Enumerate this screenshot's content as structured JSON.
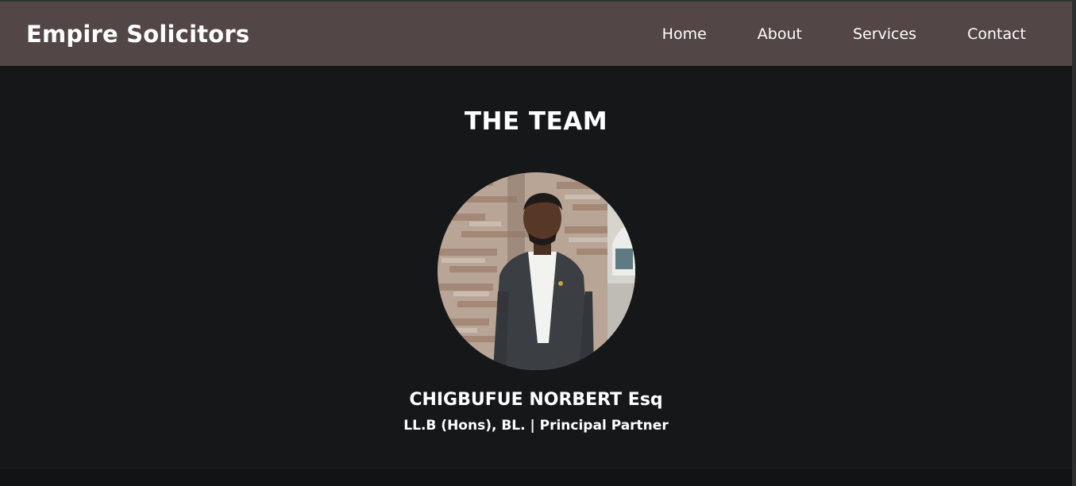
{
  "brand": {
    "name": "Empire Solicitors"
  },
  "nav": {
    "items": [
      {
        "label": "Home"
      },
      {
        "label": "About"
      },
      {
        "label": "Services"
      },
      {
        "label": "Contact"
      }
    ]
  },
  "team": {
    "heading": "THE TEAM",
    "members": [
      {
        "name": "CHIGBUFUE NORBERT Esq",
        "title": "LL.B (Hons), BL. | Principal Partner",
        "photo_icon": "person-photo"
      }
    ]
  },
  "colors": {
    "navbar_bg": "#534646",
    "page_bg": "#161719",
    "text": "#ffffff"
  }
}
